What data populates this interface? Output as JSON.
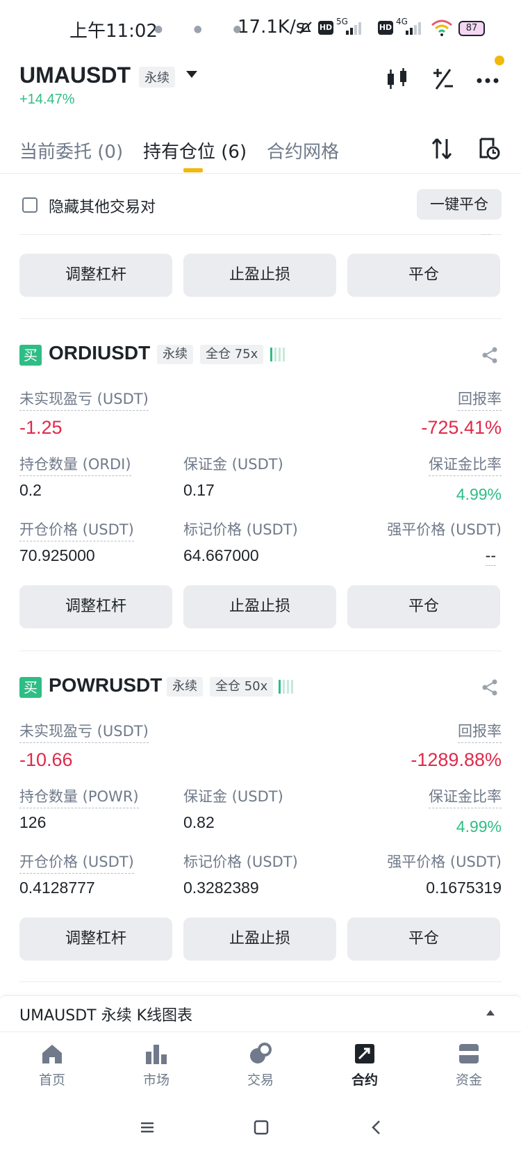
{
  "status_bar": {
    "time": "上午11:02",
    "speed": "17.1K/s",
    "net1": "5G",
    "net2": "4G",
    "hd": "HD",
    "battery": "87"
  },
  "header": {
    "symbol": "UMAUSDT",
    "contract_type": "永续",
    "change_pct": "+14.47%"
  },
  "tabs": [
    {
      "label": "当前委托 (0)"
    },
    {
      "label": "持有仓位 (6)"
    },
    {
      "label": "合约网格"
    }
  ],
  "hide_other_pairs": "隐藏其他交易对",
  "close_all": "一键平仓",
  "actions": {
    "adjust_leverage": "调整杠杆",
    "tp_sl": "止盈止损",
    "close": "平仓"
  },
  "position_labels": {
    "unrealized_pnl": "未实现盈亏 (USDT)",
    "roe": "回报率",
    "margin": "保证金 (USDT)",
    "margin_ratio": "保证金比率",
    "entry_price": "开仓价格 (USDT)",
    "mark_price": "标记价格 (USDT)",
    "liq_price": "强平价格 (USDT)"
  },
  "positions": [
    {
      "side": "买",
      "pair": "ORDIUSDT",
      "type": "永续",
      "margin_mode": "全仓 75x",
      "pnl": "-1.25",
      "roe": "-725.41%",
      "size_label": "持仓数量 (ORDI)",
      "size": "0.2",
      "margin": "0.17",
      "margin_ratio": "4.99%",
      "entry_price": "70.925000",
      "mark_price": "64.667000",
      "liq_price": "--"
    },
    {
      "side": "买",
      "pair": "POWRUSDT",
      "type": "永续",
      "margin_mode": "全仓 50x",
      "pnl": "-10.66",
      "roe": "-1289.88%",
      "size_label": "持仓数量 (POWR)",
      "size": "126",
      "margin": "0.82",
      "margin_ratio": "4.99%",
      "entry_price": "0.4128777",
      "mark_price": "0.3282389",
      "liq_price": "0.1675319"
    }
  ],
  "kline_bar": "UMAUSDT 永续  K线图表",
  "bottom_nav": [
    {
      "label": "首页"
    },
    {
      "label": "市场"
    },
    {
      "label": "交易"
    },
    {
      "label": "合约"
    },
    {
      "label": "资金"
    }
  ],
  "colors": {
    "green": "#2ebd85",
    "red": "#e0294a",
    "accent": "#f0b90b"
  }
}
